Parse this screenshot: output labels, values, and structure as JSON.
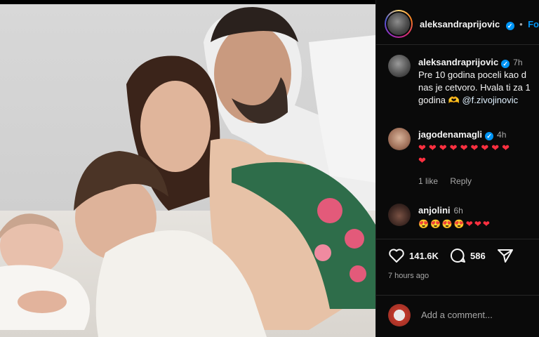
{
  "post": {
    "image_alt": "Family photo",
    "header": {
      "username": "aleksandraprijovic",
      "follow_label": "Fo",
      "dot": "•"
    },
    "caption": {
      "username": "aleksandraprijovic",
      "time": "7h",
      "lines": [
        "Pre 10 godina poceli kao d",
        "nas je cetvoro. Hvala ti za 1",
        "godina"
      ],
      "emoji": "🫶",
      "mention": "@f.zivojinovic"
    },
    "comments": [
      {
        "username": "jagodenamagli",
        "time": "4h",
        "hearts_line1": "❤❤❤❤❤❤❤❤❤",
        "hearts_line2": "❤",
        "likes": "1 like",
        "reply": "Reply"
      },
      {
        "username": "anjolini",
        "time": "6h",
        "hearts_line1": "😍😍😍😍❤❤❤"
      }
    ],
    "likes": "141.6K",
    "comments_count": "586",
    "posted_ago": "7 hours ago",
    "add_comment_placeholder": "Add a comment...",
    "colors": {
      "accent": "#0095f6",
      "heart": "#ff3040",
      "background": "#0a0a0a"
    }
  }
}
